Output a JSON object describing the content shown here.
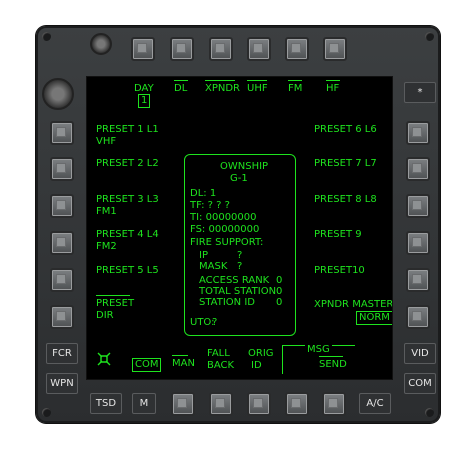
{
  "top": {
    "day_label": "DAY",
    "day_value": "1",
    "dl": "DL",
    "xpndr": "XPNDR",
    "uhf": "UHF",
    "fm": "FM",
    "hf": "HF"
  },
  "left": [
    "PRESET 1 L1",
    "VHF",
    "PRESET 2 L2",
    "PRESET 3 L3",
    "FM1",
    "PRESET 4 L4",
    "FM2",
    "PRESET 5 L5",
    "PRESET",
    "DIR"
  ],
  "right": [
    "PRESET 6 L6",
    "PRESET 7 L7",
    "PRESET 8 L8",
    "PRESET 9",
    "PRESET10",
    "XPNDR MASTER",
    "NORM"
  ],
  "ownship": {
    "title": "OWNSHIP",
    "sub": "G-1",
    "dl": "DL: 1",
    "tf": "TF: ? ? ?",
    "ti": "TI: 00000000",
    "fs": "FS: 00000000",
    "fire_support": "FIRE SUPPORT:",
    "ip": "IP",
    "ip_val": "?",
    "mask": "MASK",
    "mask_val": "?",
    "access_rank": "ACCESS RANK",
    "access_rank_val": "0",
    "total_station": "TOTAL STATION",
    "total_station_val": "0",
    "station_id": "STATION ID",
    "station_id_val": "0",
    "uto": "UTO:",
    "uto_val": "?"
  },
  "bottom": {
    "com": "COM",
    "man": "MAN",
    "fall": "FALL",
    "back": "BACK",
    "orig": "ORIG",
    "id": "ID",
    "msg": "MSG",
    "send": "SEND"
  },
  "buttons": {
    "star": "*",
    "fcr": "FCR",
    "wpn": "WPN",
    "tsd": "TSD",
    "m": "M",
    "ac": "A/C",
    "vid": "VID",
    "com": "COM"
  }
}
